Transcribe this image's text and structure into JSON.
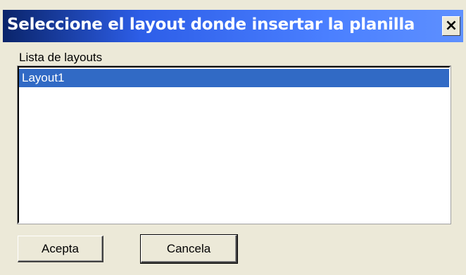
{
  "window": {
    "title": "Seleccione el layout donde insertar la planilla",
    "close_glyph": "×"
  },
  "list": {
    "label": "Lista de layouts",
    "items": [
      {
        "label": "Layout1",
        "selected": true
      }
    ]
  },
  "buttons": {
    "accept_label": "Acepta",
    "cancel_label": "Cancela"
  },
  "colors": {
    "title_gradient_start": "#0a246a",
    "title_gradient_end": "#5e90ff",
    "selection": "#316ac5",
    "dialog_face": "#ece9d8"
  }
}
